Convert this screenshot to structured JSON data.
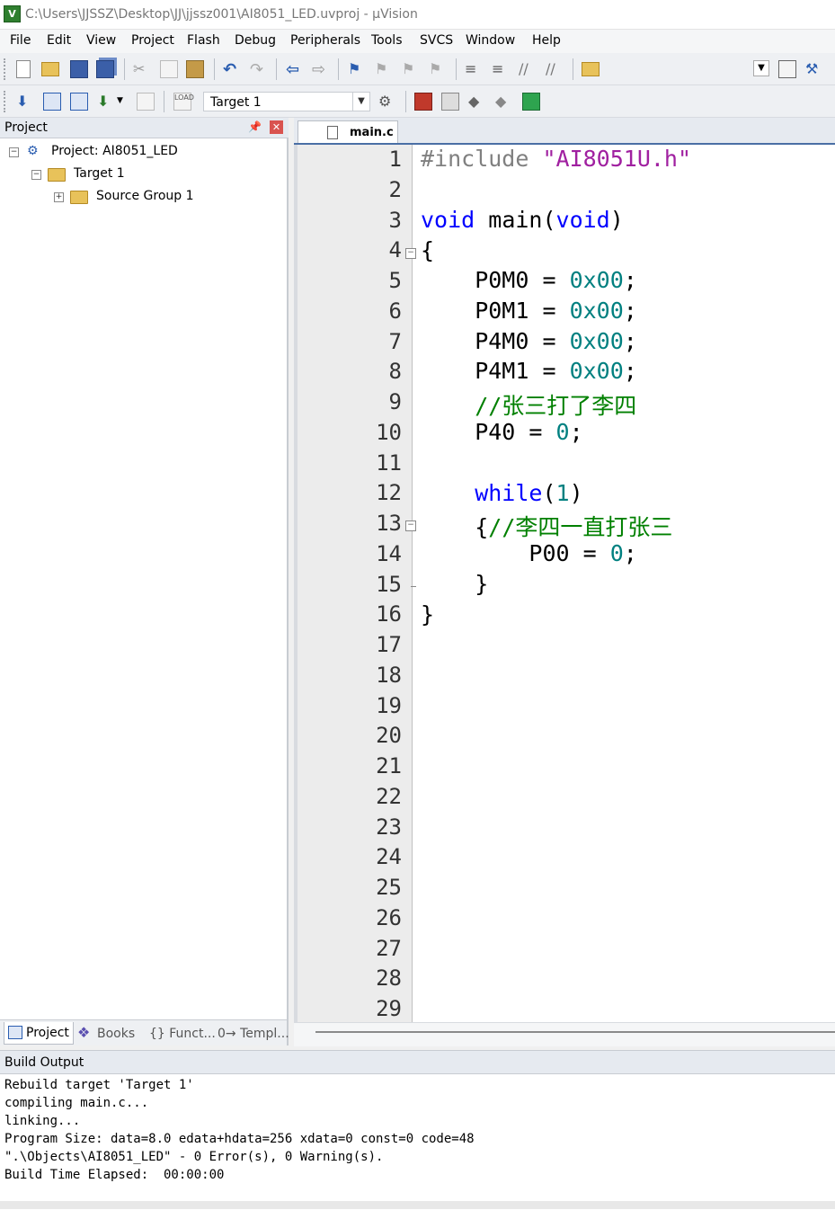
{
  "window": {
    "title": "C:\\Users\\JJSSZ\\Desktop\\JJ\\jjssz001\\AI8051_LED.uvproj - µVision",
    "app_icon": "V"
  },
  "menu": [
    "File",
    "Edit",
    "View",
    "Project",
    "Flash",
    "Debug",
    "Peripherals",
    "Tools",
    "SVCS",
    "Window",
    "Help"
  ],
  "toolbar": {
    "target_value": "Target 1"
  },
  "project_panel": {
    "title": "Project",
    "pin_icon": "pin-icon",
    "tree": {
      "project": "Project: AI8051_LED",
      "target": "Target 1",
      "group": "Source Group 1"
    },
    "tabs": [
      "Project",
      "Books",
      "{} Funct...",
      "0→ Templ..."
    ]
  },
  "editor": {
    "tab": "main.c",
    "line_numbers": [
      "1",
      "2",
      "3",
      "4",
      "5",
      "6",
      "7",
      "8",
      "9",
      "10",
      "11",
      "12",
      "13",
      "14",
      "15",
      "16",
      "17",
      "18",
      "19",
      "20",
      "21",
      "22",
      "23",
      "24",
      "25",
      "26",
      "27",
      "28",
      "29"
    ],
    "code": {
      "l1_pp": "#include ",
      "l1_str": "\"AI8051U.h\"",
      "l3_type1": "void",
      "l3_name": " main(",
      "l3_type2": "void",
      "l3_end": ")",
      "l4": "{",
      "l5_a": "    P0M0 = ",
      "l5_num": "0x00",
      "l5_end": ";",
      "l6_a": "    P0M1 = ",
      "l6_num": "0x00",
      "l6_end": ";",
      "l7_a": "    P4M0 = ",
      "l7_num": "0x00",
      "l7_end": ";",
      "l8_a": "    P4M1 = ",
      "l8_num": "0x00",
      "l8_end": ";",
      "l9_cmt": "    //张三打了李四",
      "l10_a": "    P40 = ",
      "l10_num": "0",
      "l10_end": ";",
      "l12_kw": "    while",
      "l12_a": "(",
      "l12_num": "1",
      "l12_end": ")",
      "l13_a": "    {",
      "l13_cmt": "//李四一直打张三",
      "l14_a": "        P00 = ",
      "l14_num": "0",
      "l14_end": ";",
      "l15": "    }",
      "l16": "}"
    }
  },
  "build_output": {
    "title": "Build Output",
    "lines": [
      "Rebuild target 'Target 1'",
      "compiling main.c...",
      "linking...",
      "Program Size: data=8.0 edata+hdata=256 xdata=0 const=0 code=48",
      "\".\\Objects\\AI8051_LED\" - 0 Error(s), 0 Warning(s).",
      "Build Time Elapsed:  00:00:00"
    ]
  }
}
